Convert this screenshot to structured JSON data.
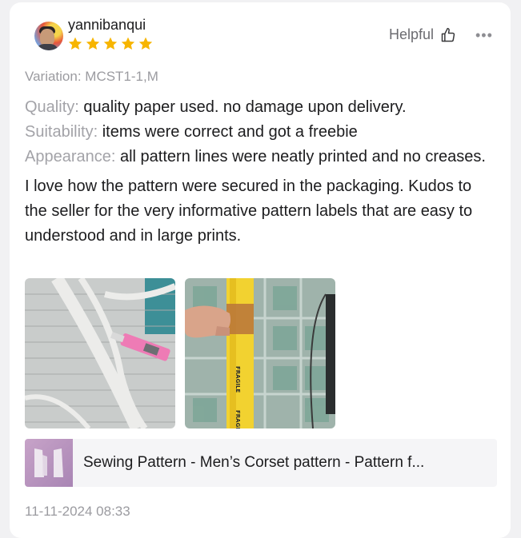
{
  "reviewer": {
    "username": "yannibanqui",
    "rating": 5,
    "rating_color": "#f7b500"
  },
  "actions": {
    "helpful_label": "Helpful",
    "helpful_icon": "thumbs-up-icon",
    "more_label": "•••"
  },
  "variation": "Variation: MCST1-1,M",
  "attributes": [
    {
      "key": "Quality:",
      "value": "quality paper used. no damage upon delivery."
    },
    {
      "key": "Suitability:",
      "value": "items were correct and got a freebie"
    },
    {
      "key": "Appearance:",
      "value": "all pattern lines were neatly printed and no creases."
    }
  ],
  "comment": "I love how the pattern were secured in the packaging. Kudos to the seller for the very informative pattern labels that are easy to understood and in large prints.",
  "photos": [
    {
      "name": "pattern-paper-with-cutter-photo"
    },
    {
      "name": "packaged-pattern-tube-photo",
      "tape_text": "FRAGILE"
    }
  ],
  "product": {
    "title": "Sewing Pattern - Men’s Corset pattern - Pattern f..."
  },
  "timestamp": "11-11-2024 08:33"
}
